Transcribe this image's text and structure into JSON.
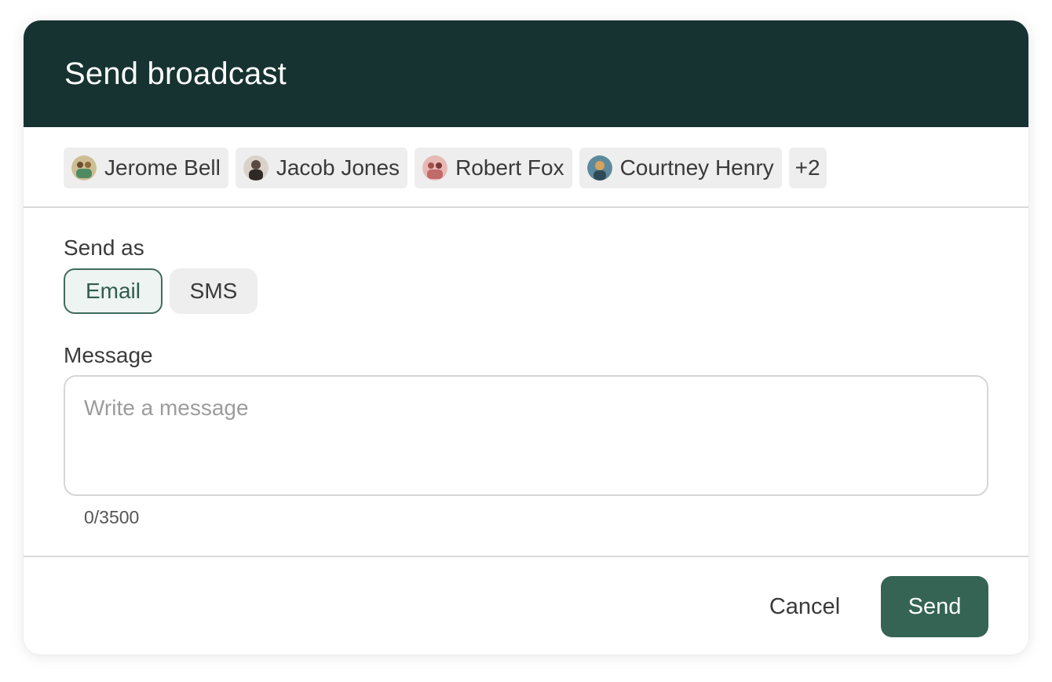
{
  "dialog": {
    "title": "Send broadcast"
  },
  "recipients": [
    {
      "name": "Jerome Bell",
      "avatar_color": "#b8a37a"
    },
    {
      "name": "Jacob Jones",
      "avatar_color": "#5a4a40"
    },
    {
      "name": "Robert Fox",
      "avatar_color": "#c06a6a"
    },
    {
      "name": "Courtney Henry",
      "avatar_color": "#5c8a9c"
    }
  ],
  "recipients_more": "+2",
  "send_as": {
    "label": "Send as",
    "options": [
      "Email",
      "SMS"
    ],
    "selected": "Email"
  },
  "message": {
    "label": "Message",
    "placeholder": "Write a message",
    "value": "",
    "counter": "0/3500"
  },
  "actions": {
    "cancel": "Cancel",
    "send": "Send"
  },
  "colors": {
    "header_bg": "#163331",
    "primary": "#356455",
    "chip_bg": "#eeeeee"
  }
}
